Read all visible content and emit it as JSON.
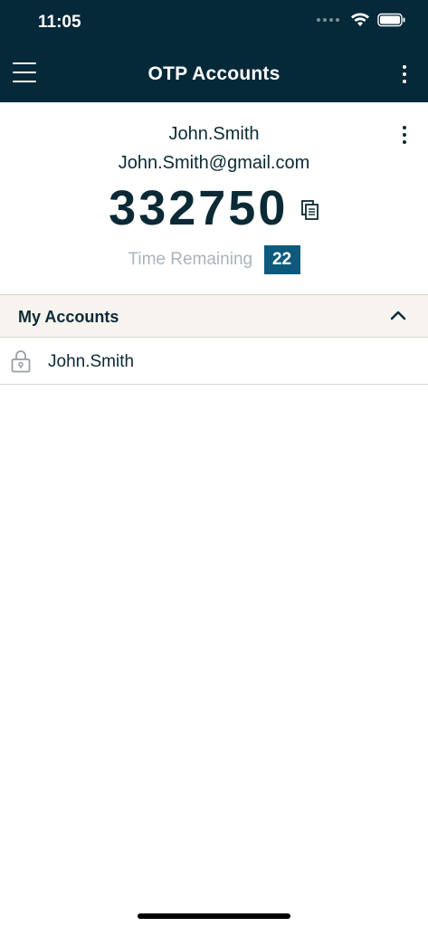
{
  "status_bar": {
    "time": "11:05"
  },
  "app_bar": {
    "title": "OTP Accounts"
  },
  "otp_card": {
    "account_name": "John.Smith",
    "email": "John.Smith@gmail.com",
    "code": "332750",
    "time_remaining_label": "Time Remaining",
    "time_remaining_seconds": "22"
  },
  "accounts_section": {
    "title": "My Accounts",
    "items": [
      {
        "label": "John.Smith",
        "icon": "lock-icon"
      }
    ]
  },
  "colors": {
    "header_bg": "#06293a",
    "accent": "#0e5a7d",
    "text_primary": "#0b2a35",
    "muted": "#a9b4bb",
    "section_bg": "#f7f4ef"
  }
}
